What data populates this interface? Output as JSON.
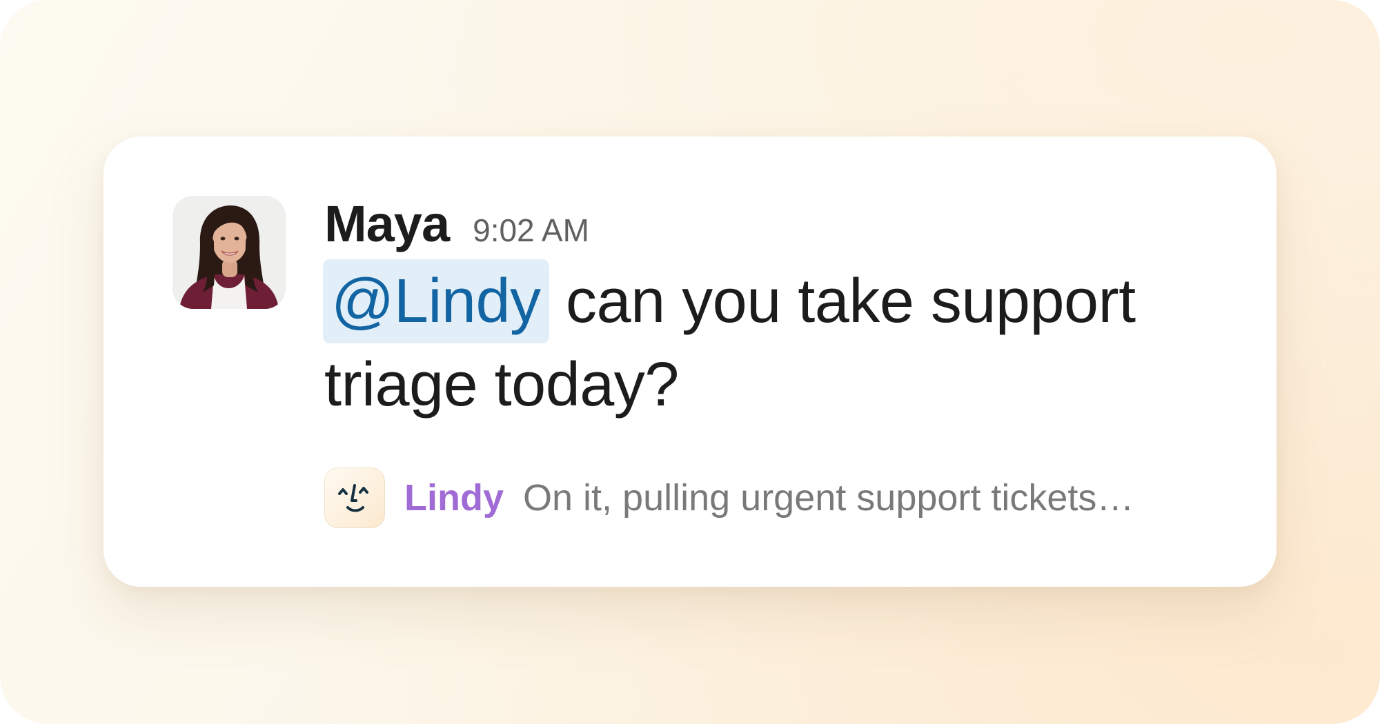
{
  "message": {
    "author": "Maya",
    "time": "9:02 AM",
    "mention": "@Lindy",
    "text_line1": " can you take support",
    "text_line2": "triage today?"
  },
  "reply": {
    "bot_name": "Lindy",
    "text": "On it, pulling urgent support tickets…"
  },
  "colors": {
    "mention_bg": "#e3eff8",
    "mention_text": "#1264a3",
    "bot_name": "#a06bd4",
    "reply_text": "#7a797a"
  },
  "icons": {
    "avatar": "user-avatar-photo",
    "bot": "lindy-face-icon"
  }
}
